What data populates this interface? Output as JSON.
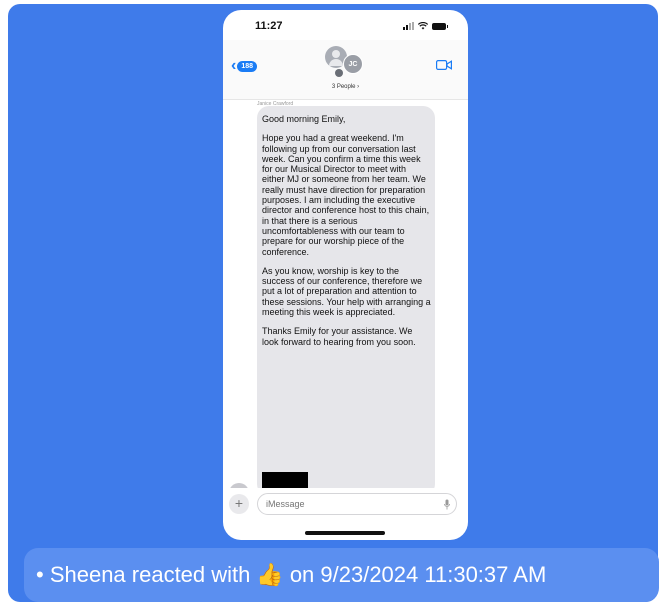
{
  "status_bar": {
    "time": "11:27"
  },
  "header": {
    "back_count": "188",
    "avatar_initials": "JC",
    "people_label": "3 People ›"
  },
  "message": {
    "sender": "Janice Crawford",
    "paragraphs": [
      "Good morning Emily,",
      "Hope you had a great weekend.  I'm following up from our conversation last week.  Can you confirm a time this week for our Musical Director to meet with either MJ or someone from her team.  We really must have direction for preparation purposes.  I am including the executive director and conference host to this chain, in that there is a serious uncomfortableness with our team to prepare for our worship piece of the conference.",
      "As you know, worship is key to the success of our conference, therefore we put a lot of preparation and attention to these sessions. Your help with arranging a meeting this week is appreciated.",
      "Thanks Emily for your assistance.  We look forward to hearing from you soon."
    ]
  },
  "composer": {
    "plus": "+",
    "placeholder": "iMessage"
  },
  "reaction": {
    "prefix": "• Sheena reacted with",
    "emoji": "👍",
    "suffix": "on 9/23/2024 11:30:37 AM"
  },
  "colors": {
    "card_bg": "#3f7bea",
    "reaction_bg": "#5b8ff0",
    "imessage_blue": "#1a7cf5"
  }
}
